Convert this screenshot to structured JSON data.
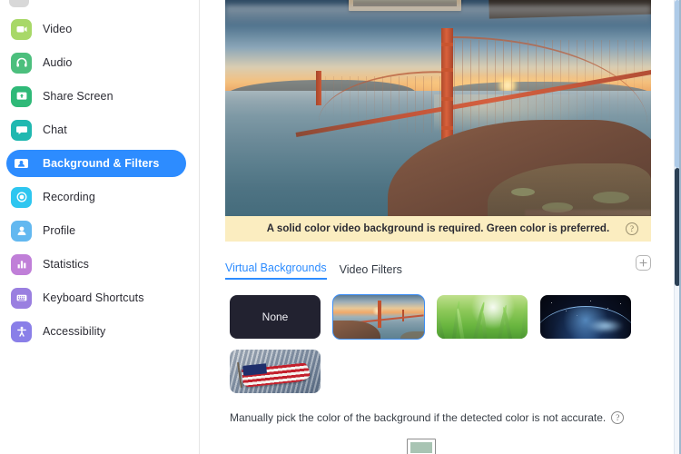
{
  "app": {
    "accent_color": "#2d8cff",
    "banner_bg": "#fbedc0"
  },
  "sidebar": {
    "items": [
      {
        "label": "Video",
        "icon": "video-camera-icon",
        "color": "#a8d868",
        "active": false
      },
      {
        "label": "Audio",
        "icon": "headphones-icon",
        "color": "#4cbf7d",
        "active": false
      },
      {
        "label": "Share Screen",
        "icon": "share-screen-icon",
        "color": "#2fb978",
        "active": false
      },
      {
        "label": "Chat",
        "icon": "chat-bubble-icon",
        "color": "#20b8b0",
        "active": false
      },
      {
        "label": "Background & Filters",
        "icon": "person-card-icon",
        "color": "#2d8cff",
        "active": true
      },
      {
        "label": "Recording",
        "icon": "record-circle-icon",
        "color": "#2ec6f0",
        "active": false
      },
      {
        "label": "Profile",
        "icon": "person-icon",
        "color": "#63b8f0",
        "active": false
      },
      {
        "label": "Statistics",
        "icon": "bar-chart-icon",
        "color": "#c07fd8",
        "active": false
      },
      {
        "label": "Keyboard Shortcuts",
        "icon": "keyboard-icon",
        "color": "#9a7fe0",
        "active": false
      },
      {
        "label": "Accessibility",
        "icon": "accessibility-icon",
        "color": "#8a7fe8",
        "active": false
      }
    ]
  },
  "preview": {
    "alt": "Golden Gate Bridge at sunset virtual background with webcam feed"
  },
  "banner": {
    "message": "A solid color video background is required. Green color is preferred.",
    "help_glyph": "?"
  },
  "tabs": [
    {
      "label": "Virtual Backgrounds",
      "active": true
    },
    {
      "label": "Video Filters",
      "active": false
    }
  ],
  "add_button": {
    "glyph": "+",
    "icon": "plus-icon"
  },
  "backgrounds": [
    {
      "name": "None",
      "label": "None",
      "type": "none",
      "selected": false
    },
    {
      "name": "Golden Gate Bridge",
      "label": "",
      "type": "bridge",
      "selected": true
    },
    {
      "name": "Grass",
      "label": "",
      "type": "grass",
      "selected": false
    },
    {
      "name": "Earth from Space",
      "label": "",
      "type": "space",
      "selected": false
    },
    {
      "name": "American Flag",
      "label": "",
      "type": "flag",
      "selected": false
    }
  ],
  "footer": {
    "hint": "Manually pick the color of the background if the detected color is not accurate.",
    "help_glyph": "?",
    "color_swatch": "#a8c4b3"
  }
}
